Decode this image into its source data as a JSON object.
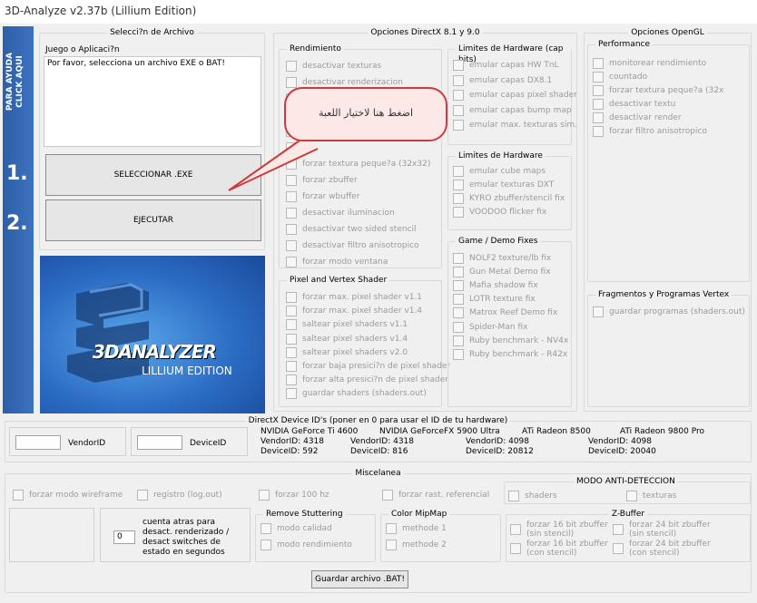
{
  "window": {
    "title": "3D-Analyze v2.37b (Lillium Edition)"
  },
  "side": {
    "help": "PARA AYUDA\nCLICK AQUI",
    "step1": "1.",
    "step2": "2."
  },
  "file": {
    "title": "Selecci?n de Archivo",
    "label": "Juego o Aplicaci?n",
    "text": "Por favor, selecciona un archivo EXE o BAT!",
    "select": "SELECCIONAR .EXE",
    "run": "EJECUTAR"
  },
  "logo": {
    "name": "3DANALYZER",
    "edition": "LILLIUM EDITION"
  },
  "callout": {
    "text": "اضغط هنا لاختيار اللعبة"
  },
  "dx": {
    "title": "Opciones DirectX 8.1 y 9.0",
    "rend": {
      "title": "Rendimiento",
      "items": [
        "desactivar texturas",
        "desactivar renderizacion",
        "",
        "",
        "",
        "se",
        "forzar textura peque?a (32x32)",
        "forzar zbuffer",
        "forzar wbuffer",
        "desactivar iluminacion",
        "desactivar two sided stencil",
        "desactivar filtro anisotropico",
        "forzar modo ventana"
      ]
    },
    "pvs": {
      "title": "Pixel and Vertex Shader",
      "items": [
        "forzar max. pixel shader v1.1",
        "forzar max. pixel shader v1.4",
        "saltear pixel shaders v1.1",
        "saltear pixel shaders v1.4",
        "saltear pixel shaders v2.0",
        "forzar baja presici?n de pixel shader",
        "forzar alta presici?n de pixel shader",
        "guardar shaders (shaders.out)"
      ]
    },
    "caps": {
      "title": "Limites de Hardware (cap bits)",
      "items": [
        "emular capas HW TnL",
        "emular capas DX8.1",
        "emular capas pixel shader",
        "emular capas bump map",
        "emular max. texturas sim."
      ]
    },
    "hw": {
      "title": "Limites de Hardware",
      "items": [
        "emular cube maps",
        "emular texturas DXT",
        "KYRO zbuffer/stencil fix",
        "VOODOO flicker fix"
      ]
    },
    "games": {
      "title": "Game / Demo Fixes",
      "items": [
        "NOLF2 texture/lb fix",
        "Gun Metal Demo fix",
        "Mafia shadow fix",
        "LOTR texture fix",
        "Matrox Reef Demo fix",
        "Spider-Man fix",
        "Ruby benchmark - NV4x",
        "Ruby benchmark - R42x"
      ]
    }
  },
  "gl": {
    "title": "Opciones OpenGL",
    "perf": {
      "title": "Performance",
      "items": [
        "monitorear rendimiento",
        "countado",
        "forzar textura peque?a (32x",
        "desactivar textu",
        "desactivar render",
        "forzar filtro anisotropico"
      ]
    },
    "frag": {
      "title": "Fragmentos y Programas Vertex",
      "items": [
        "guardar programas (shaders.out)"
      ]
    }
  },
  "ids": {
    "title": "DirectX Device ID's (poner en 0 para usar el ID de tu hardware)",
    "vendor_label": "VendorID",
    "device_label": "DeviceID",
    "vendor_value": "",
    "device_value": "",
    "cards": [
      {
        "name": "NVIDIA GeForce Ti 4600",
        "vendor": "VendorID: 4318",
        "device": "DeviceID: 592"
      },
      {
        "name": "NVIDIA GeForceFX 5900 Ultra",
        "vendor": "VendorID: 4318",
        "device": "DeviceID: 816"
      },
      {
        "name": "ATi Radeon 8500",
        "vendor": "VendorID: 4098",
        "device": "DeviceID: 20812"
      },
      {
        "name": "ATi Radeon 9800 Pro",
        "vendor": "VendorID: 4098",
        "device": "DeviceID: 20040"
      }
    ]
  },
  "misc": {
    "title": "Miscelanea",
    "items": [
      "forzar modo wireframe",
      "registro (log.out)",
      "forzar 100 hz",
      "forzar rast. referencial"
    ],
    "anti": {
      "title": "MODO ANTI-DETECCION",
      "items": [
        "shaders",
        "texturas"
      ]
    },
    "countdown": {
      "value": "0",
      "text": "cuenta atras para desact. renderizado / desact switches de estado en segundos"
    },
    "stutter": {
      "title": "Remove Stuttering",
      "items": [
        "modo calidad",
        "modo rendimiento"
      ]
    },
    "mip": {
      "title": "Color MipMap",
      "items": [
        "methode 1",
        "methode 2"
      ]
    },
    "zbuf": {
      "title": "Z-Buffer",
      "items": [
        "forzar 16 bit zbuffer (sin stencil)",
        "forzar 16 bit zbuffer (con stencil)",
        "forzar 24 bit zbuffer (sin stencil)",
        "forzar 24 bit zbuffer (con stencil)"
      ]
    },
    "save": "Guardar archivo .BAT!"
  }
}
